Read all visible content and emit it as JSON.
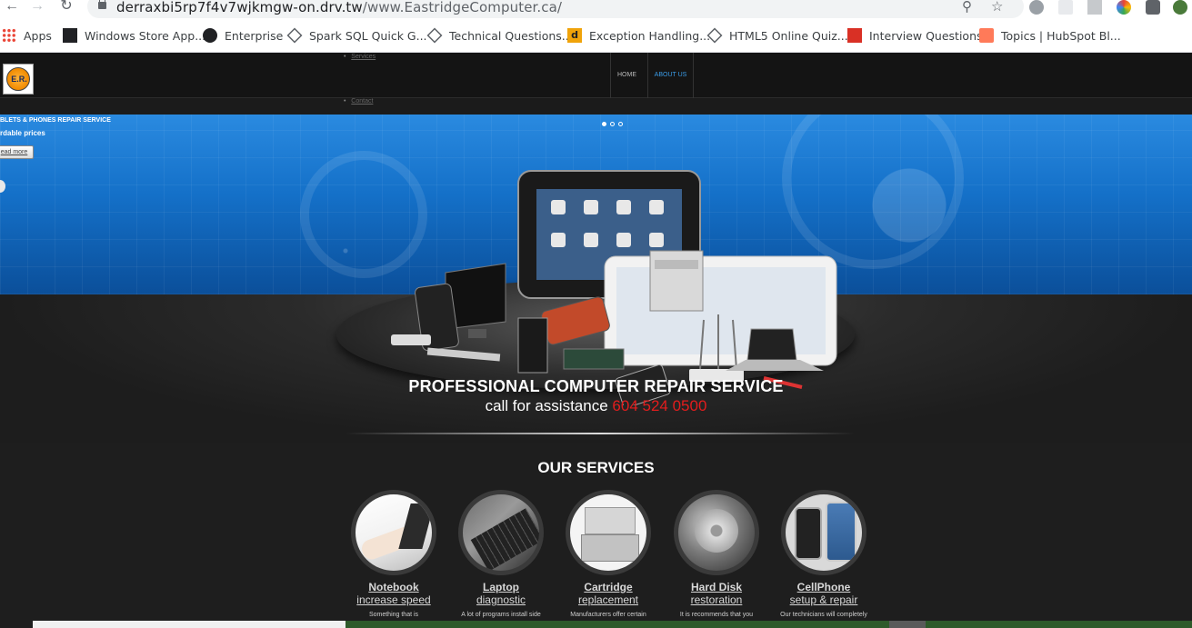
{
  "browser": {
    "url_host": "derraxbi5rp7f4v7wjkmgw-on.drv.tw",
    "url_path": "/www.EastridgeComputer.ca/",
    "bookmarks": [
      {
        "label": "Apps",
        "icon": "apps-grid-icon",
        "color": "#ea4335"
      },
      {
        "label": "Windows Store App...",
        "icon": "sdr-icon",
        "color": "#202124"
      },
      {
        "label": "Enterprise",
        "icon": "github-icon",
        "color": "#202124"
      },
      {
        "label": "Spark SQL Quick G...",
        "icon": "diamond-icon",
        "color": "#5f6368"
      },
      {
        "label": "Technical Questions...",
        "icon": "diamond-icon",
        "color": "#5f6368"
      },
      {
        "label": "Exception Handling...",
        "icon": "d-icon",
        "color": "#f0a30a"
      },
      {
        "label": "HTML5 Online Quiz...",
        "icon": "diamond-icon",
        "color": "#5f6368"
      },
      {
        "label": "Interview Questions",
        "icon": "vf-icon",
        "color": "#d93025"
      },
      {
        "label": "Topics | HubSpot Bl...",
        "icon": "hubspot-icon",
        "color": "#ff7a59"
      }
    ]
  },
  "site": {
    "logo_text": "E.R.",
    "nav": {
      "home": "HOME",
      "about": "ABOUT US",
      "active_color": "#3a9ce8",
      "stray_top": "Services",
      "stray_bottom": "Contact"
    },
    "slider": {
      "title": "BLETS & PHONES REPAIR SERVICE",
      "subtitle": "rdable prices",
      "button": "ead more"
    },
    "tagline": {
      "headline": "PROFESSIONAL COMPUTER REPAIR SERVICE",
      "call": "call for assistance",
      "phone": "604 524 0500",
      "phone_color": "#e21d1d"
    },
    "services": {
      "title": "OUR SERVICES",
      "items": [
        {
          "name": "Notebook",
          "sub": "increase speed",
          "desc": "Something that is",
          "icon": "notebook-typing-icon"
        },
        {
          "name": "Laptop",
          "sub": "diagnostic",
          "desc": "A lot of programs install side",
          "icon": "laptop-keyboard-icon"
        },
        {
          "name": "Cartridge",
          "sub": "replacement",
          "desc": "Manufacturers offer certain",
          "icon": "printer-icon"
        },
        {
          "name": "Hard Disk",
          "sub": "restoration",
          "desc": "It is recommends that you",
          "icon": "hard-disk-icon"
        },
        {
          "name": "CellPhone",
          "sub": "setup & repair",
          "desc": "Our technicians will completely",
          "icon": "smartphone-icon"
        }
      ]
    }
  }
}
